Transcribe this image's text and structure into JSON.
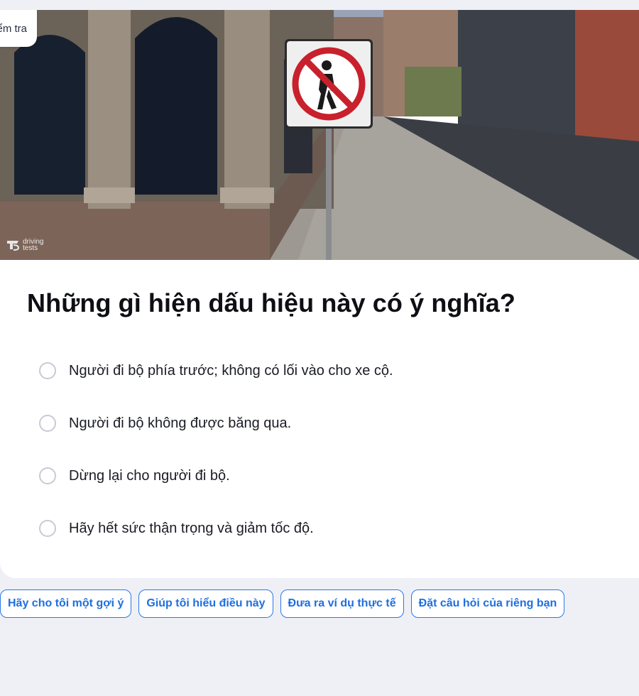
{
  "top_tab": {
    "label": "Kiểm tra"
  },
  "image": {
    "alt": "Biển báo cấm người đi bộ trên vỉa hè",
    "watermark": "driving tests",
    "sign_icon": "no-pedestrian-sign",
    "colors": {
      "sign_red": "#c8202c",
      "sign_white": "#f4f4f4"
    }
  },
  "question": {
    "text": "Những gì hiện dấu hiệu này có ý nghĩa?"
  },
  "options": [
    {
      "label": "Người đi bộ phía trước; không có lối vào cho xe cộ."
    },
    {
      "label": "Người đi bộ không được băng qua."
    },
    {
      "label": "Dừng lại cho người đi bộ."
    },
    {
      "label": "Hãy hết sức thận trọng và giảm tốc độ."
    }
  ],
  "actions": [
    {
      "label": "Hãy cho tôi một gợi ý"
    },
    {
      "label": "Giúp tôi hiểu điều này"
    },
    {
      "label": "Đưa ra ví dụ thực tế"
    },
    {
      "label": "Đặt câu hỏi của riêng bạn"
    }
  ],
  "theme": {
    "accent": "#1f6fe0",
    "background": "#eff0f6"
  }
}
